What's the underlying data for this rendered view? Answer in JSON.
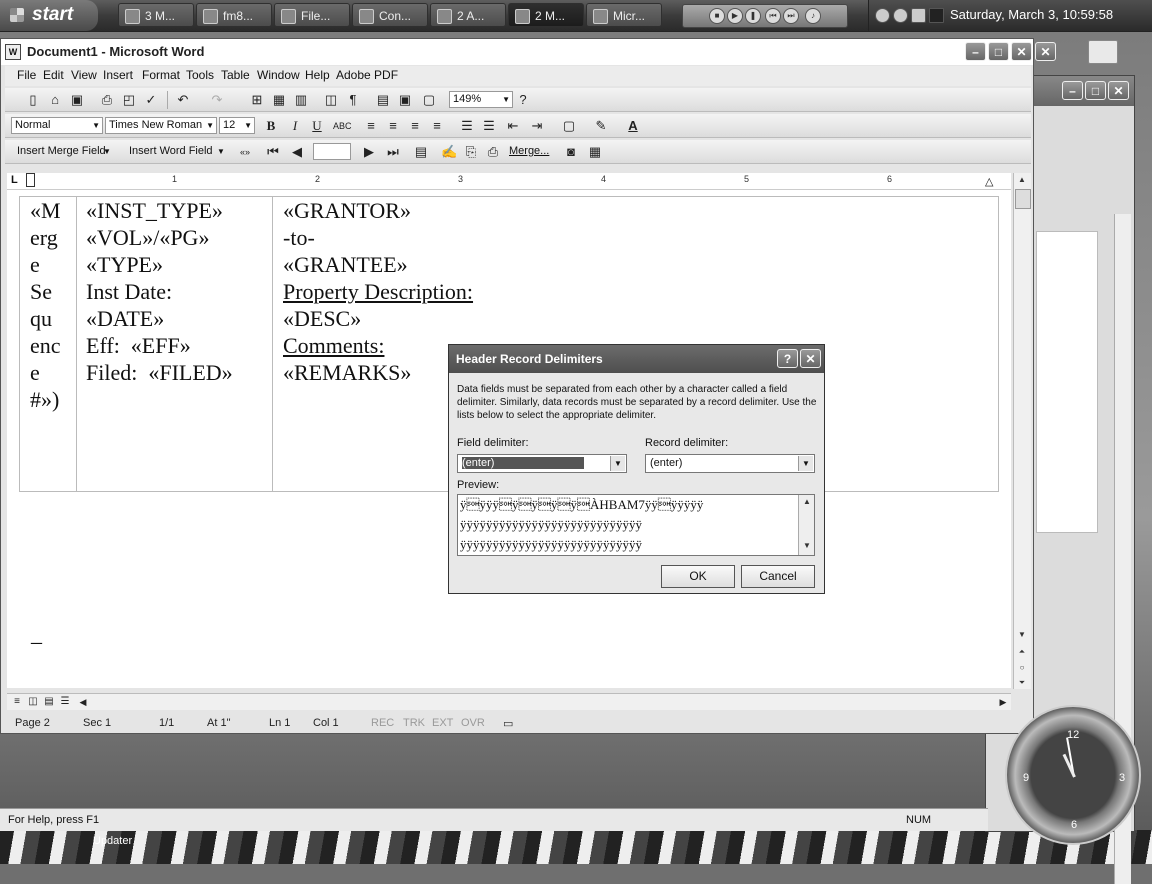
{
  "taskbar": {
    "start_label": "start",
    "buttons": [
      {
        "label": "3 M..."
      },
      {
        "label": "fm8..."
      },
      {
        "label": "File..."
      },
      {
        "label": "Con..."
      },
      {
        "label": "2 A..."
      },
      {
        "label": "2 M..."
      },
      {
        "label": "Micr..."
      }
    ],
    "clock": "Saturday, March 3,  10:59:58"
  },
  "word": {
    "title": "Document1 - Microsoft Word",
    "menu": [
      "File",
      "Edit",
      "View",
      "Insert",
      "Format",
      "Tools",
      "Table",
      "Window",
      "Help",
      "Adobe PDF"
    ],
    "zoom": "149%",
    "style": "Normal",
    "font": "Times New Roman",
    "font_size": "12",
    "mailmerge": {
      "insert_merge_field": "Insert Merge Field",
      "insert_word_field": "Insert Word Field",
      "merge": "Merge..."
    },
    "ruler_numbers": [
      "1",
      "2",
      "3",
      "4",
      "5",
      "6"
    ],
    "doc": {
      "col1": [
        "«M",
        "erg",
        "e",
        "Se",
        "qu",
        "enc",
        "e",
        "#»)"
      ],
      "col2": [
        "«INST_TYPE»",
        "",
        "«VOL»/«PG»",
        "«TYPE»",
        "",
        "Inst Date:",
        "«DATE»",
        "Eff:  «EFF»",
        "Filed:  «FILED»"
      ],
      "col3": [
        "«GRANTOR»",
        "-to-",
        "«GRANTEE»",
        "",
        "Property Description:",
        "«DESC»",
        "",
        "Comments:",
        "«REMARKS»"
      ],
      "cursor": "_"
    },
    "status": {
      "page": "Page  2",
      "sec": "Sec  1",
      "pages": "1/1",
      "at": "At  1\"",
      "ln": "Ln  1",
      "col": "Col  1",
      "rec": "REC",
      "trk": "TRK",
      "ext": "EXT",
      "ovr": "OVR"
    }
  },
  "helpbar": {
    "text": "For Help, press F1",
    "num": "NUM"
  },
  "desktop": {
    "updater_label": "Updater"
  },
  "dialog": {
    "title": "Header Record Delimiters",
    "description": "Data fields must be separated from each other by a character called a field delimiter. Similarly, data records must be separated by a record delimiter. Use the lists below to select the appropriate delimiter.",
    "field_delimiter_label": "Field delimiter:",
    "field_delimiter_value": "(enter)",
    "record_delimiter_label": "Record delimiter:",
    "record_delimiter_value": "(enter)",
    "preview_label": "Preview:",
    "preview_lines": [
      "ÿ\u0001ÿÿÿ\u0001ÿ\u0001ÿ\u0001ÿ\u0001ÿ\u0001ÀHBAM7ÿÿ\u0001ÿÿÿÿÿ",
      "ÿÿÿÿÿÿÿÿÿÿÿÿÿÿÿÿÿÿÿÿÿÿÿÿÿÿÿÿ",
      "ÿÿÿÿÿÿÿÿÿÿÿÿÿÿÿÿÿÿÿÿÿÿÿÿÿÿÿÿ"
    ],
    "ok_label": "OK",
    "cancel_label": "Cancel"
  }
}
